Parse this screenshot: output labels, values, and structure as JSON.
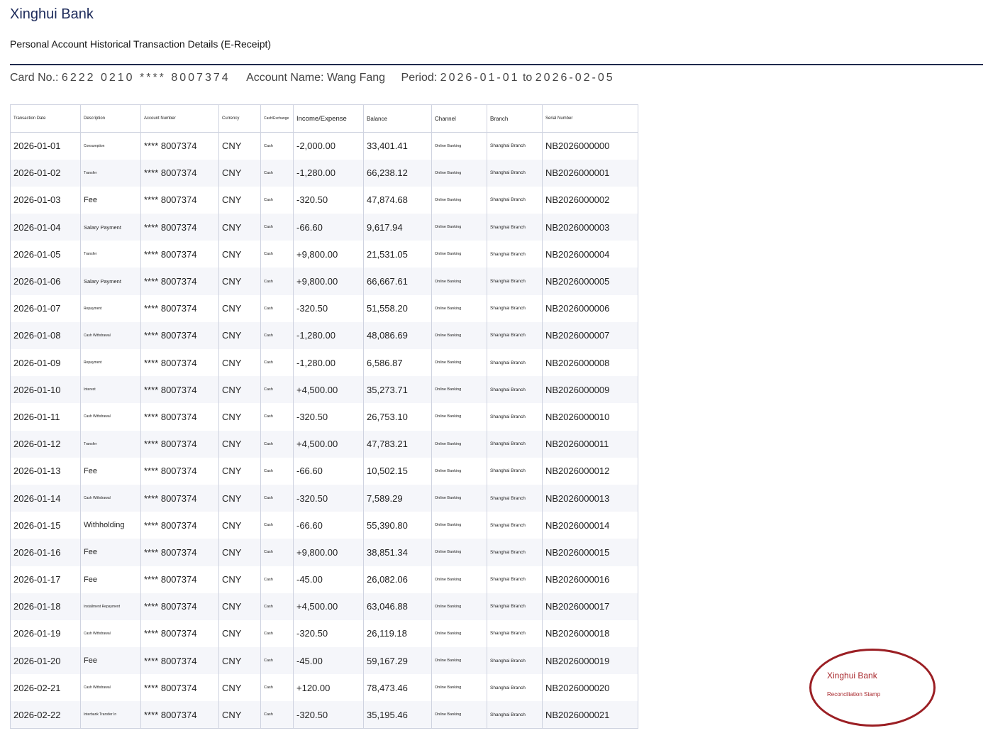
{
  "header": {
    "bank_name": "Xinghui Bank",
    "title": "Personal Account Historical Transaction Details (E-Receipt)"
  },
  "meta": {
    "card_label": "Card No.:",
    "card_value": "6222 0210 **** 8007374",
    "account_label": "Account Name:",
    "account_value": "Wang Fang",
    "period_label": "Period:",
    "period_start": "2026-01-01",
    "period_to": "to",
    "period_end": "2026-02-05"
  },
  "table": {
    "columns": [
      "Transaction Date",
      "Description",
      "Account Number",
      "Currency",
      "Cash/Exchange",
      "Income/Expense",
      "Balance",
      "Channel",
      "Branch",
      "Serial Number"
    ],
    "rows": [
      {
        "date": "2026-01-01",
        "desc": "Consumption",
        "account": "**** 8007374",
        "currency": "CNY",
        "cash": "Cash",
        "amount": "-2,000.00",
        "balance": "33,401.41",
        "channel": "Online Banking",
        "branch": "Shanghai Branch",
        "serial": "NB2026000000"
      },
      {
        "date": "2026-01-02",
        "desc": "Transfer",
        "account": "**** 8007374",
        "currency": "CNY",
        "cash": "Cash",
        "amount": "-1,280.00",
        "balance": "66,238.12",
        "channel": "Online Banking",
        "branch": "Shanghai Branch",
        "serial": "NB2026000001"
      },
      {
        "date": "2026-01-03",
        "desc": "Fee",
        "account": "**** 8007374",
        "currency": "CNY",
        "cash": "Cash",
        "amount": "-320.50",
        "balance": "47,874.68",
        "channel": "Online Banking",
        "branch": "Shanghai Branch",
        "serial": "NB2026000002"
      },
      {
        "date": "2026-01-04",
        "desc": "Salary Payment",
        "account": "**** 8007374",
        "currency": "CNY",
        "cash": "Cash",
        "amount": "-66.60",
        "balance": "9,617.94",
        "channel": "Online Banking",
        "branch": "Shanghai Branch",
        "serial": "NB2026000003"
      },
      {
        "date": "2026-01-05",
        "desc": "Transfer",
        "account": "**** 8007374",
        "currency": "CNY",
        "cash": "Cash",
        "amount": "+9,800.00",
        "balance": "21,531.05",
        "channel": "Online Banking",
        "branch": "Shanghai Branch",
        "serial": "NB2026000004"
      },
      {
        "date": "2026-01-06",
        "desc": "Salary Payment",
        "account": "**** 8007374",
        "currency": "CNY",
        "cash": "Cash",
        "amount": "+9,800.00",
        "balance": "66,667.61",
        "channel": "Online Banking",
        "branch": "Shanghai Branch",
        "serial": "NB2026000005"
      },
      {
        "date": "2026-01-07",
        "desc": "Repayment",
        "account": "**** 8007374",
        "currency": "CNY",
        "cash": "Cash",
        "amount": "-320.50",
        "balance": "51,558.20",
        "channel": "Online Banking",
        "branch": "Shanghai Branch",
        "serial": "NB2026000006"
      },
      {
        "date": "2026-01-08",
        "desc": "Cash Withdrawal",
        "account": "**** 8007374",
        "currency": "CNY",
        "cash": "Cash",
        "amount": "-1,280.00",
        "balance": "48,086.69",
        "channel": "Online Banking",
        "branch": "Shanghai Branch",
        "serial": "NB2026000007"
      },
      {
        "date": "2026-01-09",
        "desc": "Repayment",
        "account": "**** 8007374",
        "currency": "CNY",
        "cash": "Cash",
        "amount": "-1,280.00",
        "balance": "6,586.87",
        "channel": "Online Banking",
        "branch": "Shanghai Branch",
        "serial": "NB2026000008"
      },
      {
        "date": "2026-01-10",
        "desc": "Interest",
        "account": "**** 8007374",
        "currency": "CNY",
        "cash": "Cash",
        "amount": "+4,500.00",
        "balance": "35,273.71",
        "channel": "Online Banking",
        "branch": "Shanghai Branch",
        "serial": "NB2026000009"
      },
      {
        "date": "2026-01-11",
        "desc": "Cash Withdrawal",
        "account": "**** 8007374",
        "currency": "CNY",
        "cash": "Cash",
        "amount": "-320.50",
        "balance": "26,753.10",
        "channel": "Online Banking",
        "branch": "Shanghai Branch",
        "serial": "NB2026000010"
      },
      {
        "date": "2026-01-12",
        "desc": "Transfer",
        "account": "**** 8007374",
        "currency": "CNY",
        "cash": "Cash",
        "amount": "+4,500.00",
        "balance": "47,783.21",
        "channel": "Online Banking",
        "branch": "Shanghai Branch",
        "serial": "NB2026000011"
      },
      {
        "date": "2026-01-13",
        "desc": "Fee",
        "account": "**** 8007374",
        "currency": "CNY",
        "cash": "Cash",
        "amount": "-66.60",
        "balance": "10,502.15",
        "channel": "Online Banking",
        "branch": "Shanghai Branch",
        "serial": "NB2026000012"
      },
      {
        "date": "2026-01-14",
        "desc": "Cash Withdrawal",
        "account": "**** 8007374",
        "currency": "CNY",
        "cash": "Cash",
        "amount": "-320.50",
        "balance": "7,589.29",
        "channel": "Online Banking",
        "branch": "Shanghai Branch",
        "serial": "NB2026000013"
      },
      {
        "date": "2026-01-15",
        "desc": "Withholding",
        "account": "**** 8007374",
        "currency": "CNY",
        "cash": "Cash",
        "amount": "-66.60",
        "balance": "55,390.80",
        "channel": "Online Banking",
        "branch": "Shanghai Branch",
        "serial": "NB2026000014"
      },
      {
        "date": "2026-01-16",
        "desc": "Fee",
        "account": "**** 8007374",
        "currency": "CNY",
        "cash": "Cash",
        "amount": "+9,800.00",
        "balance": "38,851.34",
        "channel": "Online Banking",
        "branch": "Shanghai Branch",
        "serial": "NB2026000015"
      },
      {
        "date": "2026-01-17",
        "desc": "Fee",
        "account": "**** 8007374",
        "currency": "CNY",
        "cash": "Cash",
        "amount": "-45.00",
        "balance": "26,082.06",
        "channel": "Online Banking",
        "branch": "Shanghai Branch",
        "serial": "NB2026000016"
      },
      {
        "date": "2026-01-18",
        "desc": "Installment Repayment",
        "account": "**** 8007374",
        "currency": "CNY",
        "cash": "Cash",
        "amount": "+4,500.00",
        "balance": "63,046.88",
        "channel": "Online Banking",
        "branch": "Shanghai Branch",
        "serial": "NB2026000017"
      },
      {
        "date": "2026-01-19",
        "desc": "Cash Withdrawal",
        "account": "**** 8007374",
        "currency": "CNY",
        "cash": "Cash",
        "amount": "-320.50",
        "balance": "26,119.18",
        "channel": "Online Banking",
        "branch": "Shanghai Branch",
        "serial": "NB2026000018"
      },
      {
        "date": "2026-01-20",
        "desc": "Fee",
        "account": "**** 8007374",
        "currency": "CNY",
        "cash": "Cash",
        "amount": "-45.00",
        "balance": "59,167.29",
        "channel": "Online Banking",
        "branch": "Shanghai Branch",
        "serial": "NB2026000019"
      },
      {
        "date": "2026-02-21",
        "desc": "Cash Withdrawal",
        "account": "**** 8007374",
        "currency": "CNY",
        "cash": "Cash",
        "amount": "+120.00",
        "balance": "78,473.46",
        "channel": "Online Banking",
        "branch": "Shanghai Branch",
        "serial": "NB2026000020"
      },
      {
        "date": "2026-02-22",
        "desc": "Interbank Transfer In",
        "account": "**** 8007374",
        "currency": "CNY",
        "cash": "Cash",
        "amount": "-320.50",
        "balance": "35,195.46",
        "channel": "Online Banking",
        "branch": "Shanghai Branch",
        "serial": "NB2026000021"
      }
    ]
  },
  "stamp": {
    "bank": "Xinghui Bank",
    "subtitle": "Reconciliation Stamp"
  },
  "colors": {
    "title_blue": "#1c2a5a",
    "rule": "#1f2a4d",
    "income_red": "#b0262b",
    "stamp_red": "#9b1f24"
  }
}
